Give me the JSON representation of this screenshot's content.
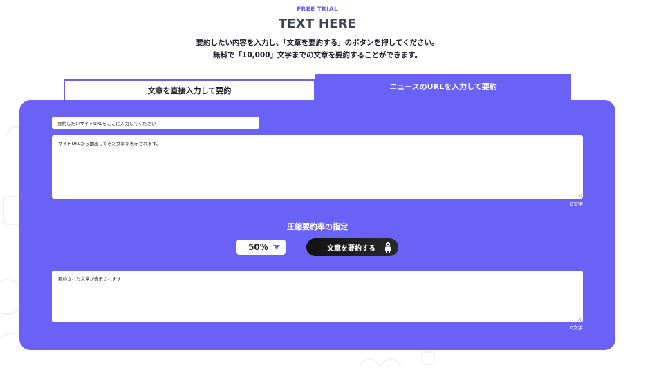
{
  "header": {
    "eyebrow": "FREE TRIAL",
    "title": "TEXT HERE",
    "desc_line1": "要約したい内容を入力し、「文章を要約する」のボタンを押してください。",
    "desc_line2": "無料で「10,000」文字までの文章を要約することができます。"
  },
  "tabs": [
    {
      "label": "文章を直接入力して要約",
      "active": false
    },
    {
      "label": "ニュースのURLを入力して要約",
      "active": true
    }
  ],
  "form": {
    "url_placeholder": "要約したいサイトURLをここに入力してください",
    "source_text": "サイトURLから抽出してきた文章が表示されます。",
    "source_count": "0文字",
    "ratio_label": "圧縮要約率の指定",
    "ratio_value": "50%",
    "summarize_label": "文章を要約する",
    "result_text": "要約された文章が表示されます",
    "result_count": "0文字"
  },
  "colors": {
    "accent": "#6a61f6",
    "eyebrow": "#6a5cf0",
    "button": "#111111"
  }
}
